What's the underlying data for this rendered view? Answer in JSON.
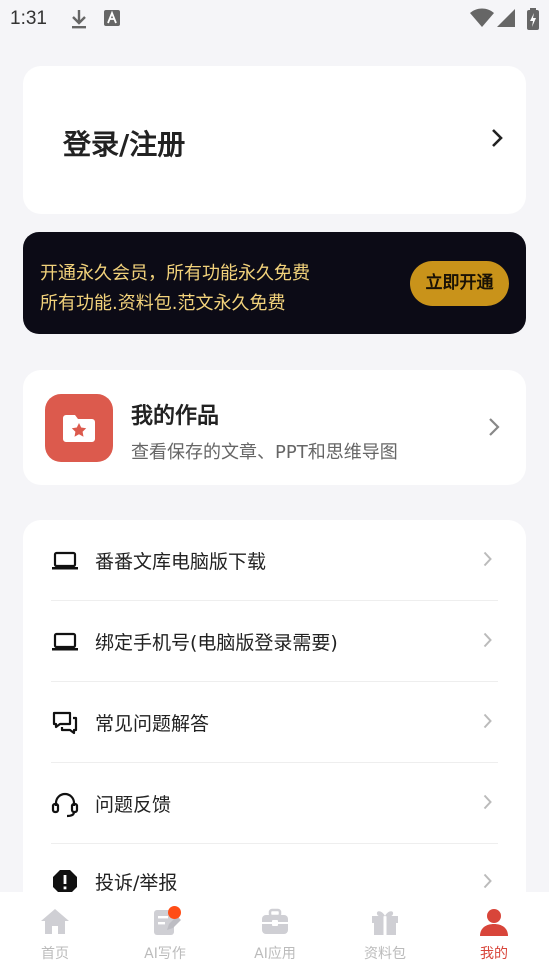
{
  "status_bar": {
    "time": "1:31"
  },
  "login": {
    "label": "登录/注册"
  },
  "vip": {
    "line1": "开通永久会员，所有功能永久免费",
    "line2": "所有功能.资料包.范文永久免费",
    "button": "立即开通",
    "colors": {
      "background": "#0c0b16",
      "text": "#f2d27b",
      "button": "#c9931a"
    }
  },
  "works": {
    "title": "我的作品",
    "subtitle": "查看保存的文章、PPT和思维导图",
    "icon": "folder-star-icon",
    "icon_color": "#dc5a4d"
  },
  "menu": {
    "items": [
      {
        "label": "番番文库电脑版下载",
        "icon": "laptop-icon"
      },
      {
        "label": "绑定手机号(电脑版登录需要)",
        "icon": "laptop-icon"
      },
      {
        "label": "常见问题解答",
        "icon": "chat-bubbles-icon"
      },
      {
        "label": "问题反馈",
        "icon": "headset-icon"
      },
      {
        "label": "投诉/举报",
        "icon": "alert-octagon-icon"
      }
    ]
  },
  "tabbar": {
    "active_color": "#d8453a",
    "tabs": [
      {
        "label": "首页",
        "icon": "home-icon",
        "active": false
      },
      {
        "label": "AI写作",
        "icon": "write-icon",
        "active": false,
        "badge": true
      },
      {
        "label": "AI应用",
        "icon": "toolbox-icon",
        "active": false
      },
      {
        "label": "资料包",
        "icon": "gift-icon",
        "active": false
      },
      {
        "label": "我的",
        "icon": "user-icon",
        "active": true
      }
    ]
  }
}
